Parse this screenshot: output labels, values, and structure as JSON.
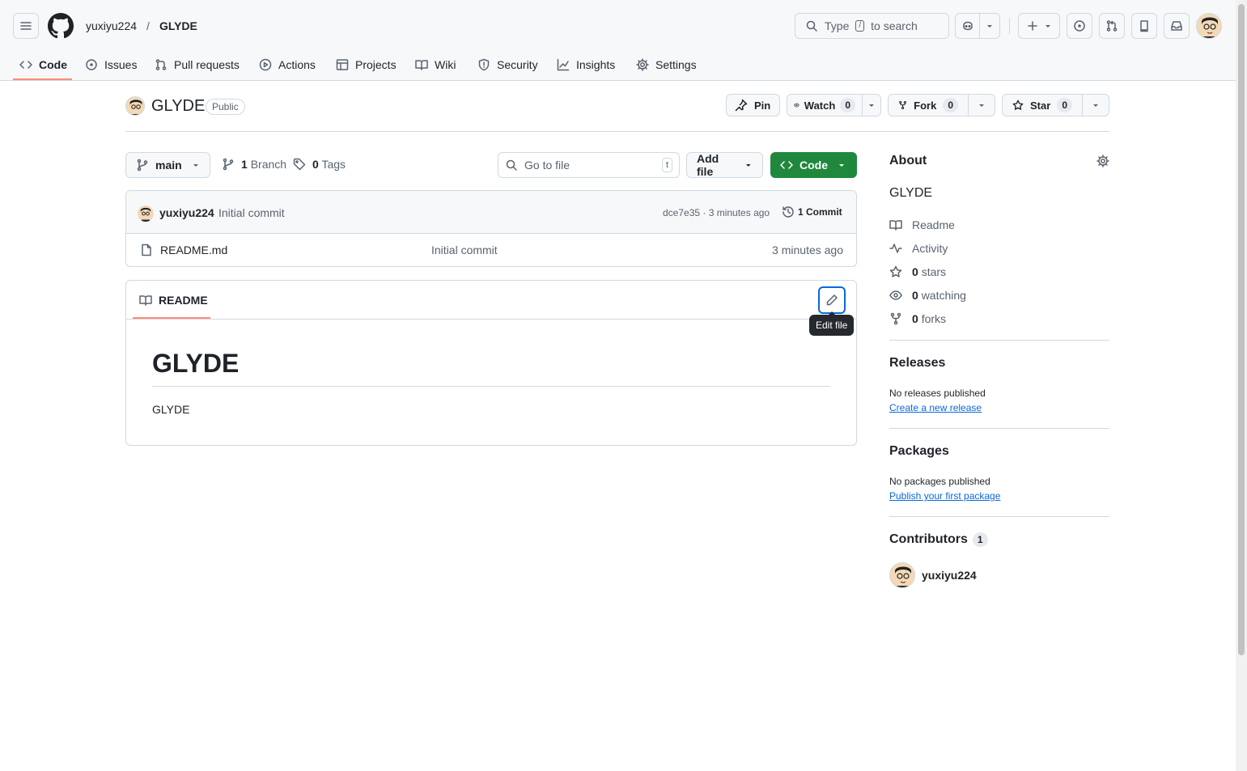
{
  "header": {
    "owner": "yuxiyu224",
    "separator": "/",
    "repo": "GLYDE",
    "search_prefix": "Type",
    "search_key": "/",
    "search_suffix": "to search"
  },
  "tabs": [
    {
      "label": "Code",
      "icon": "code-icon"
    },
    {
      "label": "Issues",
      "icon": "issue-icon"
    },
    {
      "label": "Pull requests",
      "icon": "pull-request-icon"
    },
    {
      "label": "Actions",
      "icon": "play-icon"
    },
    {
      "label": "Projects",
      "icon": "table-icon"
    },
    {
      "label": "Wiki",
      "icon": "book-icon"
    },
    {
      "label": "Security",
      "icon": "shield-icon"
    },
    {
      "label": "Insights",
      "icon": "graph-icon"
    },
    {
      "label": "Settings",
      "icon": "gear-icon"
    }
  ],
  "repo": {
    "name": "GLYDE",
    "visibility": "Public",
    "pin_label": "Pin",
    "watch_label": "Watch",
    "watch_count": "0",
    "fork_label": "Fork",
    "fork_count": "0",
    "star_label": "Star",
    "star_count": "0"
  },
  "toolbar": {
    "branch": "main",
    "branch_count": "1",
    "branch_label": "Branch",
    "tag_count": "0",
    "tag_label": "Tags",
    "goto_placeholder": "Go to file",
    "goto_key": "t",
    "add_file_label": "Add file",
    "code_label": "Code"
  },
  "commit": {
    "author": "yuxiyu224",
    "message": "Initial commit",
    "hash_time": "dce7e35 · 3 minutes ago",
    "count_label": "1 Commit"
  },
  "files": [
    {
      "name": "README.md",
      "message": "Initial commit",
      "time": "3 minutes ago"
    }
  ],
  "readme": {
    "tab_label": "README",
    "tooltip": "Edit file",
    "heading": "GLYDE",
    "body": "GLYDE"
  },
  "about": {
    "title": "About",
    "description": "GLYDE",
    "readme": "Readme",
    "activity": "Activity",
    "stars_count": "0",
    "stars_label": "stars",
    "watching_count": "0",
    "watching_label": "watching",
    "forks_count": "0",
    "forks_label": "forks"
  },
  "releases": {
    "title": "Releases",
    "empty": "No releases published",
    "link": "Create a new release"
  },
  "packages": {
    "title": "Packages",
    "empty": "No packages published",
    "link": "Publish your first package"
  },
  "contributors": {
    "title": "Contributors",
    "count": "1",
    "items": [
      {
        "name": "yuxiyu224"
      }
    ]
  },
  "colors": {
    "accent_green": "#1f883d",
    "link_blue": "#0969da",
    "tab_underline": "#fd8c73"
  }
}
